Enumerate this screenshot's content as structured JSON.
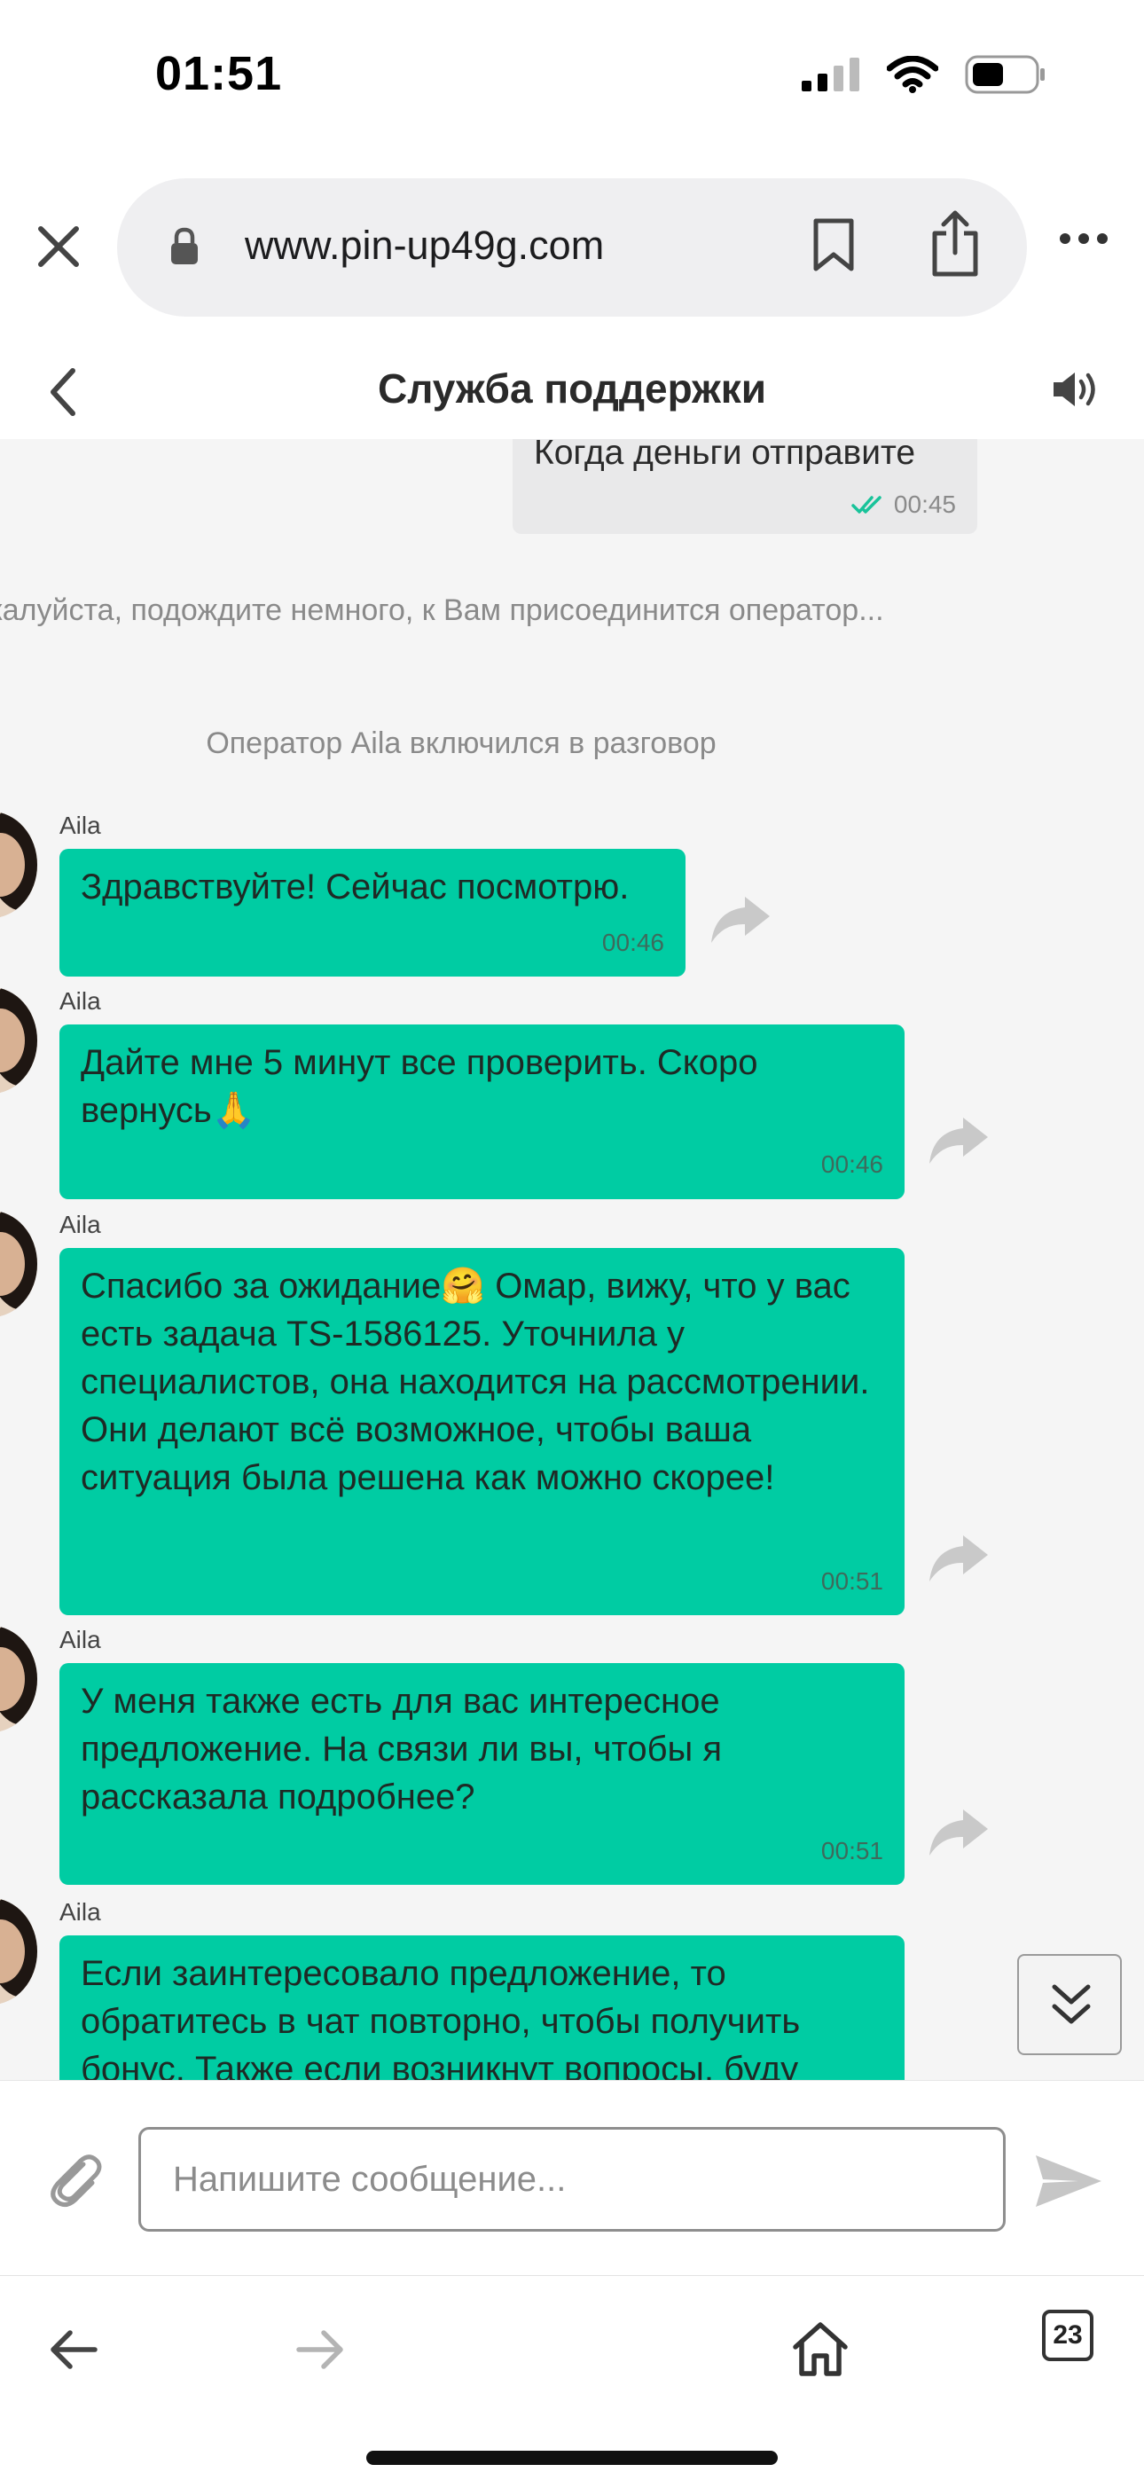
{
  "status_bar": {
    "time": "01:51"
  },
  "browser": {
    "url": "www.pin-up49g.com",
    "open_tabs": "23"
  },
  "chat": {
    "title": "Служба поддержки",
    "user_message": {
      "text": "Когда деньги отправите",
      "time": "00:45"
    },
    "system_waiting": "жалуйста, подождите немного, к Вам присоединится оператор...",
    "system_joined": "Оператор Aila включился в разговор",
    "operator_messages": [
      {
        "sender": "Aila",
        "text": "Здравствуйте! Сейчас посмотрю.",
        "time": "00:46"
      },
      {
        "sender": "Aila",
        "text": "Дайте мне 5 минут все проверить. Скоро вернусь🙏",
        "time": "00:46"
      },
      {
        "sender": "Aila",
        "text": "Спасибо за ожидание🤗 Омар, вижу, что у вас есть задача TS-1586125. Уточнила у специалистов, она находится на рассмотрении. Они делают всё возможное, чтобы ваша ситуация была решена как можно скорее!",
        "time": "00:51"
      },
      {
        "sender": "Aila",
        "text": "У меня также есть для вас интересное предложение. На связи ли вы, чтобы я рассказала подробнее?",
        "time": "00:51"
      },
      {
        "sender": "Aila",
        "text": "Если заинтересовало предложение, то обратитесь в чат повторно, чтобы получить бонус. Также если возникнут вопросы, буду",
        "time": ""
      }
    ]
  },
  "composer": {
    "placeholder": "Напишите сообщение..."
  },
  "colors": {
    "operator_bubble": "#00cca3",
    "user_bubble": "#e9e9ea",
    "read_check": "#19c39a",
    "chat_background": "#f5f5f5"
  },
  "icons": {
    "close": "close-icon",
    "lock": "lock-icon",
    "bookmark": "bookmark-icon",
    "share": "share-icon",
    "more": "more-icon",
    "back": "chevron-left-icon",
    "sound": "speaker-icon",
    "forward_message": "forward-arrow-icon",
    "scroll_down": "double-chevron-down-icon",
    "attach": "paperclip-icon",
    "send": "send-icon",
    "nav_back": "arrow-left-icon",
    "nav_forward": "arrow-right-icon",
    "home": "home-icon"
  }
}
